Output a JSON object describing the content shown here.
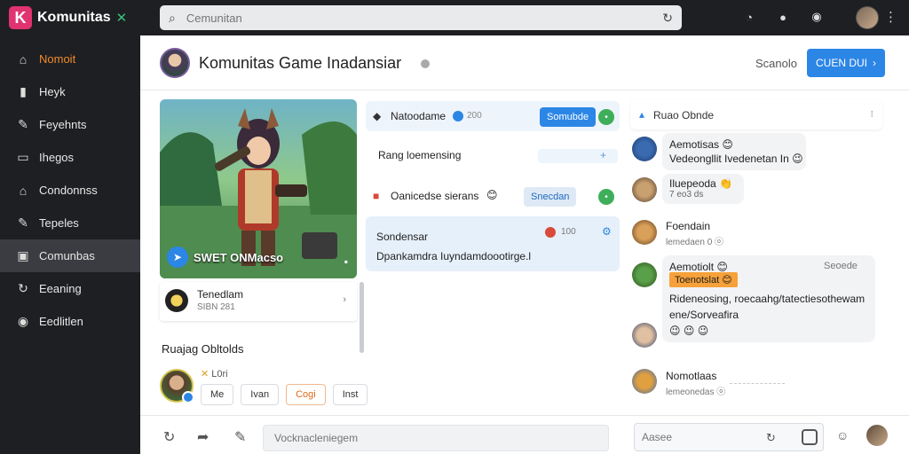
{
  "app": {
    "logo_letter": "K",
    "name": "Komunitas"
  },
  "search": {
    "placeholder": "Cemunitan"
  },
  "sidebar": {
    "items": [
      {
        "label": "Nomoit",
        "icon": "home-icon",
        "accent": true
      },
      {
        "label": "Heyk",
        "icon": "bookmark-icon"
      },
      {
        "label": "Feyehnts",
        "icon": "pin-icon"
      },
      {
        "label": "Ihegos",
        "icon": "image-icon"
      },
      {
        "label": "Condonnss",
        "icon": "home-icon"
      },
      {
        "label": "Tepeles",
        "icon": "pin-icon"
      },
      {
        "label": "Comunbas",
        "icon": "community-icon",
        "active": true
      },
      {
        "label": "Eeaning",
        "icon": "sync-icon"
      },
      {
        "label": "Eedlitlen",
        "icon": "target-icon"
      }
    ]
  },
  "header": {
    "title": "Komunitas Game Inadansiar",
    "link": "Scanolo",
    "join_label": "CUEN DUI"
  },
  "game_card": {
    "title": "SWET ONMacso"
  },
  "member": {
    "name": "Tenedlam",
    "sub": "SIBN 281"
  },
  "section": {
    "title": "Ruajag Obltolds",
    "meta": "L0ri",
    "tags": [
      "Me",
      "Ivan",
      "Cogi",
      "Inst"
    ]
  },
  "channels": [
    {
      "name": "Natoodame",
      "stat": "200",
      "pill": "Somubde"
    },
    {
      "name": "Rang loemensing"
    },
    {
      "name": "Oanicedse sierans",
      "pill": "Snecdan"
    }
  ],
  "post": {
    "title": "Sondensar",
    "body": "Dpankamdra Iuyndamdoootirge.l",
    "stat": "100"
  },
  "chat": {
    "title": "Ruao Obnde",
    "messages": [
      {
        "name": "Aemotisas 😊",
        "text": "Vedeongllit Ivedenetan In 😉"
      },
      {
        "name": "Iluepeoda 👏",
        "text": "7 eo3 ds"
      },
      {
        "name": "Foendain",
        "text": "lemedaen 0 ⓞ"
      },
      {
        "name": "Aemotiolt 😊",
        "label": "Toenotslat 😊",
        "status": "Seoede",
        "text": "Rideneosing, roecaahg/tatectiesothewam",
        "text2": "ene/Sorveafira",
        "reactions": "😉 😉 😉"
      },
      {
        "name": "Nomotlaas",
        "text": "lemeonedas ⓞ"
      }
    ]
  },
  "composer": {
    "placeholder": "Vocknacleniegem",
    "search_placeholder": "Aasee"
  }
}
